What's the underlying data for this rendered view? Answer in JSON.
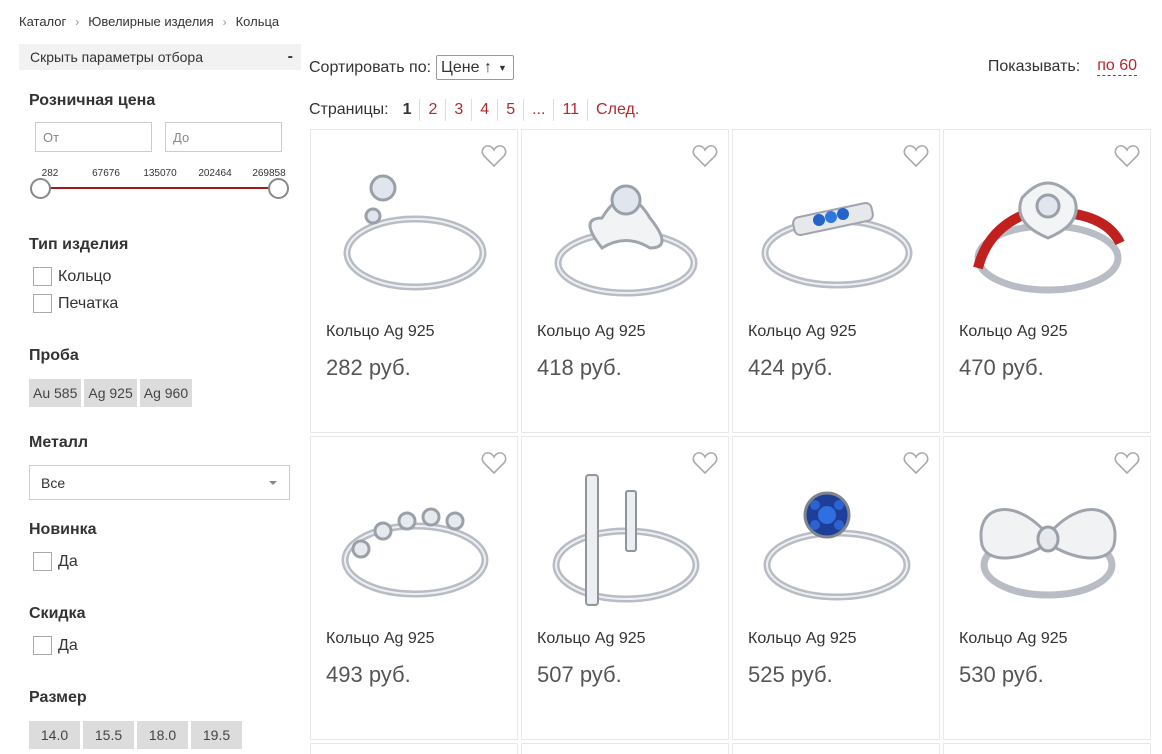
{
  "breadcrumb": [
    "Каталог",
    "Ювелирные изделия",
    "Кольца"
  ],
  "sidebar": {
    "toggle_label": "Скрыть параметры отбора",
    "toggle_icon": "-",
    "price": {
      "title": "Розничная цена",
      "from_placeholder": "От",
      "to_placeholder": "До",
      "ticks": [
        "282",
        "67676",
        "135070",
        "202464",
        "269858"
      ],
      "range": [
        282,
        269858
      ]
    },
    "type": {
      "title": "Тип изделия",
      "options": [
        "Кольцо",
        "Печатка"
      ]
    },
    "proba": {
      "title": "Проба",
      "options": [
        "Au 585",
        "Ag 925",
        "Ag 960"
      ]
    },
    "metal": {
      "title": "Металл",
      "selected": "Все"
    },
    "new": {
      "title": "Новинка",
      "option": "Да"
    },
    "discount": {
      "title": "Скидка",
      "option": "Да"
    },
    "size": {
      "title": "Размер",
      "options": [
        "14.0",
        "15.5",
        "18.0",
        "19.5"
      ]
    }
  },
  "sort": {
    "label": "Сортировать по:",
    "value": "Цене ↑"
  },
  "show": {
    "label": "Показывать:",
    "value": "по 60"
  },
  "pager": {
    "label": "Страницы:",
    "pages": [
      "1",
      "2",
      "3",
      "4",
      "5",
      "...",
      "11"
    ],
    "current": "1",
    "next": "След."
  },
  "products": [
    {
      "name": "Кольцо Ag 925",
      "price": "282 руб.",
      "style": "open-stones"
    },
    {
      "name": "Кольцо Ag 925",
      "price": "418 руб.",
      "style": "flower"
    },
    {
      "name": "Кольцо Ag 925",
      "price": "424 руб.",
      "style": "blue-row"
    },
    {
      "name": "Кольцо Ag 925",
      "price": "470 руб.",
      "style": "red-enamel"
    },
    {
      "name": "Кольцо Ag 925",
      "price": "493 руб.",
      "style": "stone-row"
    },
    {
      "name": "Кольцо Ag 925",
      "price": "507 руб.",
      "style": "bars"
    },
    {
      "name": "Кольцо Ag 925",
      "price": "525 руб.",
      "style": "blue-cluster"
    },
    {
      "name": "Кольцо Ag 925",
      "price": "530 руб.",
      "style": "bow"
    }
  ],
  "colors": {
    "accent": "#b5272d",
    "chip": "#dcdcdc",
    "slider": "#a31a1a"
  }
}
